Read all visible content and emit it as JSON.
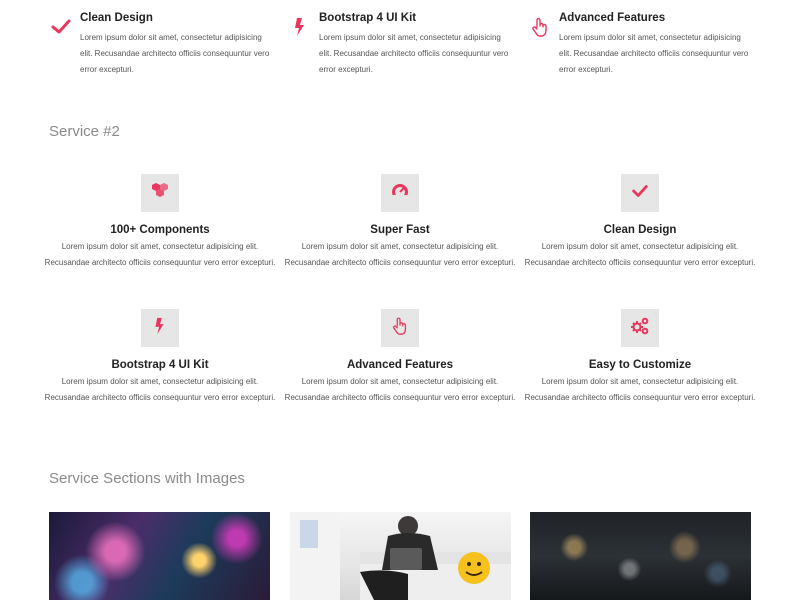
{
  "accent_color": "#e8365d",
  "top_features": [
    {
      "icon": "check-icon",
      "title": "Clean Design",
      "text": "Lorem ipsum dolor sit amet, consectetur adipisicing elit. Recusandae architecto officiis consequuntur vero error excepturi."
    },
    {
      "icon": "bolt-icon",
      "title": "Bootstrap 4 UI Kit",
      "text": "Lorem ipsum dolor sit amet, consectetur adipisicing elit. Recusandae architecto officiis consequuntur vero error excepturi."
    },
    {
      "icon": "pointer-hand-icon",
      "title": "Advanced Features",
      "text": "Lorem ipsum dolor sit amet, consectetur adipisicing elit. Recusandae architecto officiis consequuntur vero error excepturi."
    }
  ],
  "service2": {
    "heading": "Service #2",
    "items": [
      {
        "icon": "cubes-icon",
        "title": "100+ Components",
        "text": "Lorem ipsum dolor sit amet, consectetur adipisicing elit. Recusandae architecto officiis consequuntur vero error excepturi."
      },
      {
        "icon": "speedometer-icon",
        "title": "Super Fast",
        "text": "Lorem ipsum dolor sit amet, consectetur adipisicing elit. Recusandae architecto officiis consequuntur vero error excepturi."
      },
      {
        "icon": "check-icon",
        "title": "Clean Design",
        "text": "Lorem ipsum dolor sit amet, consectetur adipisicing elit. Recusandae architecto officiis consequuntur vero error excepturi."
      },
      {
        "icon": "bolt-icon",
        "title": "Bootstrap 4 UI Kit",
        "text": "Lorem ipsum dolor sit amet, consectetur adipisicing elit. Recusandae architecto officiis consequuntur vero error excepturi."
      },
      {
        "icon": "pointer-hand-icon",
        "title": "Advanced Features",
        "text": "Lorem ipsum dolor sit amet, consectetur adipisicing elit. Recusandae architecto officiis consequuntur vero error excepturi."
      },
      {
        "icon": "gears-icon",
        "title": "Easy to Customize",
        "text": "Lorem ipsum dolor sit amet, consectetur adipisicing elit. Recusandae architecto officiis consequuntur vero error excepturi."
      }
    ]
  },
  "images_section": {
    "heading": "Service Sections with Images"
  }
}
